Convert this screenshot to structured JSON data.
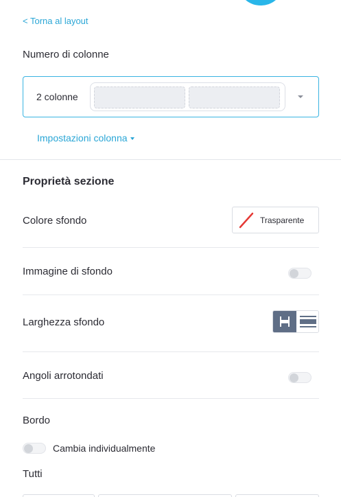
{
  "nav": {
    "back_label": "< Torna al layout"
  },
  "columns": {
    "label": "Numero di colonne",
    "selected": "2 colonne",
    "settings_label": "Impostazioni colonna"
  },
  "section": {
    "heading": "Proprietà sezione",
    "background_color": {
      "label": "Colore sfondo",
      "value": "Trasparente"
    },
    "background_image": {
      "label": "Immagine di sfondo",
      "enabled": false
    },
    "background_width": {
      "label": "Larghezza sfondo",
      "selected": "first"
    },
    "rounded_corners": {
      "label": "Angoli arrotondati",
      "enabled": false
    },
    "border": {
      "label": "Bordo",
      "individual_label": "Cambia individualmente",
      "individual_enabled": false,
      "all_label": "Tutti"
    }
  },
  "colors": {
    "accent": "#2aa6d6",
    "select_border": "#38b3e1",
    "selected_segment": "#5f6e86",
    "transparent_slash": "#e53935"
  },
  "icons": {
    "back": "chevron-left",
    "select_caret": "caret-down",
    "transparent_swatch": "transparent-slash-icon",
    "width_contained": "contained-width-icon",
    "width_full": "full-width-icon"
  }
}
